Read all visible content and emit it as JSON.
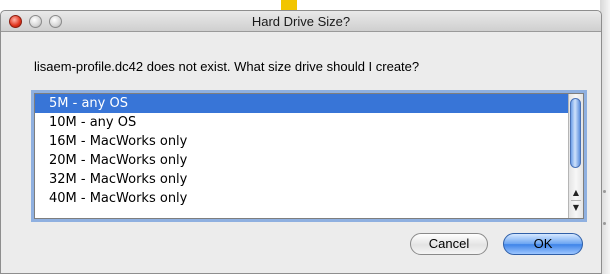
{
  "window": {
    "title": "Hard Drive Size?"
  },
  "dialog": {
    "message": "lisaem-profile.dc42 does not exist.  What size drive should I create?",
    "options": [
      "5M - any OS",
      "10M - any OS",
      "16M - MacWorks only",
      "20M - MacWorks only",
      "32M - MacWorks only",
      "40M - MacWorks only"
    ],
    "selected_option": "5M - any OS"
  },
  "buttons": {
    "cancel": "Cancel",
    "ok": "OK"
  },
  "icons": {
    "close": "close-light-icon",
    "minimize": "minimize-light-icon",
    "zoom": "zoom-light-icon",
    "scroll_up": "arrow-up-icon",
    "scroll_down": "arrow-down-icon"
  },
  "colors": {
    "selection": "#3875d7",
    "focus_ring": "#8fb0e0",
    "default_button": "#3d83e8"
  }
}
